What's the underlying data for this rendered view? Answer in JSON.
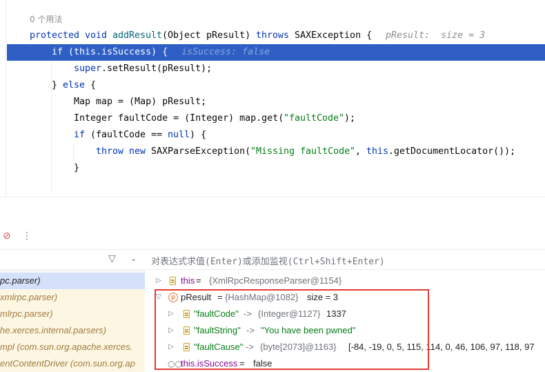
{
  "editor": {
    "usage_hint": "0 个用法",
    "line1": {
      "kw_protected": "protected",
      "kw_void": "void",
      "method": "addResult",
      "sig": "(Object pResult) ",
      "kw_throws": "throws",
      "exc": " SAXException {",
      "hint": "pResult:  size = 3"
    },
    "line2": {
      "kw_if": "if",
      "code": " (this.isSuccess) {",
      "hint": "isSuccess: false"
    },
    "line3": {
      "kw_super": "super",
      "code": ".setResult(pResult);"
    },
    "line4": {
      "open": "} ",
      "kw_else": "else",
      "close": " {"
    },
    "line5": {
      "code": "Map map = (Map) pResult;"
    },
    "line6": {
      "code1": "Integer faultCode = (Integer) map.get(",
      "str": "\"faultCode\"",
      "code2": ");"
    },
    "line7": {
      "kw_if": "if",
      "code1": " (faultCode == ",
      "kw_null": "null",
      "code2": ") {"
    },
    "line8": {
      "kw_throw": "throw",
      "kw_new": "new",
      "code1": " SAXParseException(",
      "str": "\"Missing faultCode\"",
      "code2": ", ",
      "kw_this": "this",
      "code3": ".getDocumentLocator());"
    },
    "line9": {
      "code": "}"
    }
  },
  "debugger": {
    "toolbar": {
      "mute_icon": "mute-breakpoints-icon",
      "more_icon": "more-icon"
    },
    "frames_header": {
      "filter_icon": "filter-icon",
      "dropdown_icon": "chevron-down-icon"
    },
    "frames": [
      "pc.parser)",
      "xmlrpc.parser)",
      "mlrpc.parser)",
      "he.xerces.internal.parsers)",
      "mpl (com.sun.org.apache.xerces.",
      "entContentDriver (com.sun.org.ap"
    ],
    "eval_placeholder": "对表达式求值(Enter)或添加监视(Ctrl+Shift+Enter)",
    "variables": {
      "this": {
        "name": "this",
        "eq": " = ",
        "value": "{XmlRpcResponseParser@1154}"
      },
      "presult": {
        "name": "pResult",
        "eq": " = ",
        "value": "{HashMap@1082}",
        "size": "size = 3"
      },
      "entry1": {
        "key": "\"faultCode\"",
        "arrow": " -> ",
        "type": "{Integer@1127}",
        "value": "1337"
      },
      "entry2": {
        "key": "\"faultString\"",
        "arrow": " -> ",
        "value": "\"You have been pwned\""
      },
      "entry3": {
        "key": "\"faultCause\"",
        "arrow": " -> ",
        "type": "{byte[2073]@1163}",
        "value": "[-84, -19, 0, 5, 115, 114, 0, 46, 106, 97, 118, 97"
      },
      "watch": {
        "name": "this.isSuccess",
        "eq": " = ",
        "value": "false"
      }
    },
    "highlight_color": "#e53935"
  }
}
